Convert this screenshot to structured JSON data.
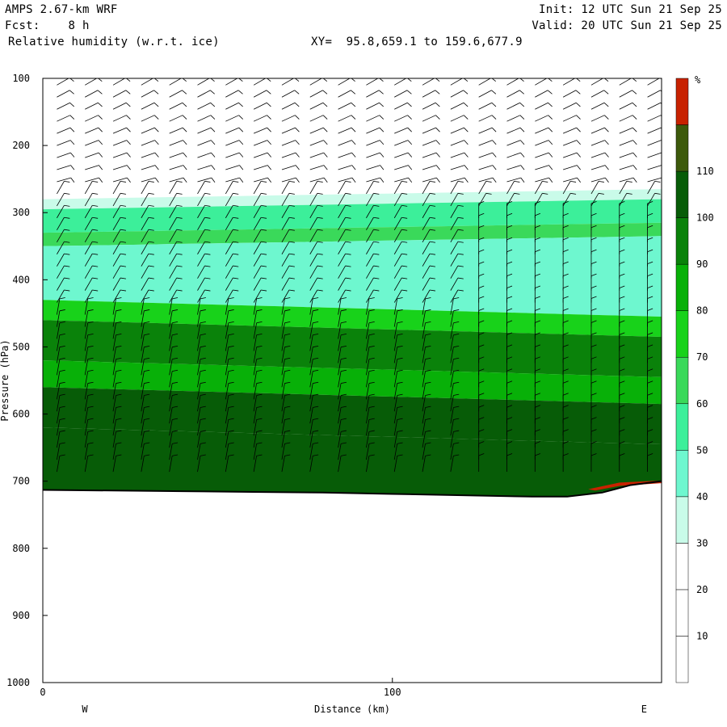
{
  "header": {
    "model": "AMPS 2.67-km WRF",
    "forecast": "Fcst:    8 h",
    "field": "Relative humidity (w.r.t. ice)",
    "xy": "XY=  95.8,659.1 to 159.6,677.9",
    "init": "Init: 12 UTC Sun 21 Sep 25",
    "valid": "Valid: 20 UTC Sun 21 Sep 25"
  },
  "chart_data": {
    "type": "contour_cross_section",
    "variable": "Relative humidity (w.r.t. ice)",
    "ylabel": "Pressure (hPa)",
    "xlabel": "Distance (km)",
    "yticks": [
      100,
      200,
      300,
      400,
      500,
      600,
      700,
      800,
      900,
      1000
    ],
    "xticks": [
      0,
      100
    ],
    "ylim": [
      1000,
      100
    ],
    "xlim_km": [
      0,
      177
    ],
    "x_end_labels": {
      "left": "W",
      "right": "E"
    },
    "colorbar": {
      "unit": "%",
      "levels": [
        10,
        20,
        30,
        40,
        50,
        60,
        70,
        80,
        90,
        100,
        110
      ],
      "colors": [
        "#ffffff",
        "#ffffff",
        "#ffffff",
        "#c9fbe9",
        "#6ef7cf",
        "#3cef9a",
        "#3ad95a",
        "#18d21a",
        "#08b008",
        "#0a820a",
        "#075c07",
        "#3d5a0b",
        "#c82200"
      ]
    },
    "terrain_pressure_hPa": [
      [
        0,
        713
      ],
      [
        20,
        714
      ],
      [
        40,
        715
      ],
      [
        60,
        716
      ],
      [
        80,
        717
      ],
      [
        100,
        719
      ],
      [
        120,
        721
      ],
      [
        140,
        723
      ],
      [
        150,
        723
      ],
      [
        160,
        717
      ],
      [
        168,
        706
      ],
      [
        177,
        700
      ]
    ],
    "rh_bands_hPa": [
      {
        "p_top": 280,
        "p_bottom": 295,
        "rh": 35
      },
      {
        "p_top": 295,
        "p_bottom": 330,
        "rh": 55
      },
      {
        "p_top": 330,
        "p_bottom": 350,
        "rh": 60
      },
      {
        "p_top": 350,
        "p_bottom": 430,
        "rh": 45
      },
      {
        "p_top": 430,
        "p_bottom": 460,
        "rh": 70
      },
      {
        "p_top": 460,
        "p_bottom": 520,
        "rh": 90
      },
      {
        "p_top": 520,
        "p_bottom": 560,
        "rh": 80
      },
      {
        "p_top": 560,
        "p_bottom": 620,
        "rh": 105
      },
      {
        "p_top": 620,
        "p_bottom": 715,
        "rh": 100
      }
    ],
    "wind_barbs": "present (upper-level westerly/northwesterly barbs above cloud top; dense barbs in lower layer)"
  }
}
